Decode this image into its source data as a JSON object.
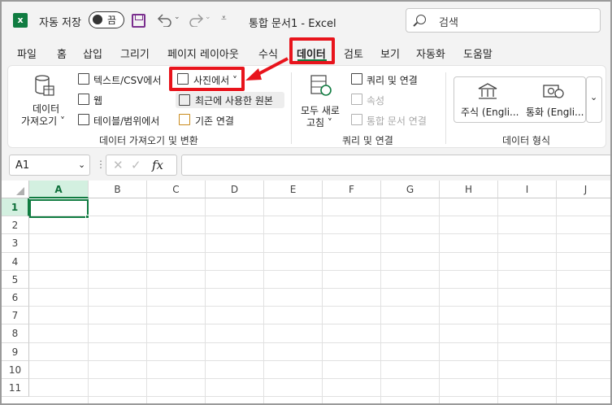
{
  "app": {
    "logo_letter": "x",
    "autosave_label": "자동 저장",
    "autosave_state": "끔",
    "document_title": "통합 문서1  -  Excel",
    "search_placeholder": "검색"
  },
  "tabs": [
    {
      "label": "파일"
    },
    {
      "label": "홈"
    },
    {
      "label": "삽입"
    },
    {
      "label": "그리기"
    },
    {
      "label": "페이지 레이아웃"
    },
    {
      "label": "수식"
    },
    {
      "label": "데이터",
      "active": true
    },
    {
      "label": "검토"
    },
    {
      "label": "보기"
    },
    {
      "label": "자동화"
    },
    {
      "label": "도움말"
    }
  ],
  "ribbon": {
    "get_data": {
      "line1": "데이터",
      "line2": "가져오기 ˅"
    },
    "from_text_csv": "텍스트/CSV에서",
    "from_web": "웹",
    "from_table_range": "테이블/범위에서",
    "from_picture": "사진에서 ˅",
    "recent_sources": "최근에 사용한 원본",
    "existing_connections": "기존 연결",
    "group_get_transform": "데이터 가져오기 및 변환",
    "refresh_all": {
      "line1": "모두 새로",
      "line2": "고침 ˅"
    },
    "queries_connections": "쿼리 및 연결",
    "properties": "속성",
    "edit_links": "통합 문서 연결",
    "group_queries": "쿼리 및 연결",
    "stocks": "주식 (Engli...",
    "currencies": "통화 (Engli...",
    "group_data_types": "데이터 형식",
    "accent_color": "#107c41",
    "highlight_color": "#e8141c"
  },
  "formula_bar": {
    "cell_ref": "A1",
    "fx_label": "fx",
    "formula": ""
  },
  "grid": {
    "columns": [
      "A",
      "B",
      "C",
      "D",
      "E",
      "F",
      "G",
      "H",
      "I",
      "J"
    ],
    "rows": [
      "1",
      "2",
      "3",
      "4",
      "5",
      "6",
      "7",
      "8",
      "9",
      "10",
      "11"
    ],
    "selected_cell": "A1"
  }
}
